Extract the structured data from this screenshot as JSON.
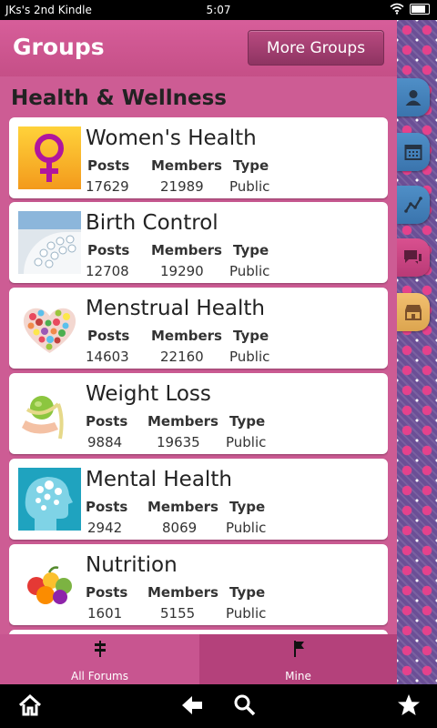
{
  "status_bar": {
    "device_name": "JKs's 2nd Kindle",
    "time": "5:07"
  },
  "header": {
    "title": "Groups",
    "more_groups_label": "More Groups"
  },
  "section_title": "Health & Wellness",
  "labels": {
    "posts": "Posts",
    "members": "Members",
    "type": "Type"
  },
  "groups": [
    {
      "name": "Women's Health",
      "posts": "17629",
      "members": "21989",
      "type": "Public",
      "thumb_icon": "female-symbol-icon"
    },
    {
      "name": "Birth Control",
      "posts": "12708",
      "members": "19290",
      "type": "Public",
      "thumb_icon": "pill-pack-icon"
    },
    {
      "name": "Menstrual Health",
      "posts": "14603",
      "members": "22160",
      "type": "Public",
      "thumb_icon": "heart-collage-icon"
    },
    {
      "name": "Weight Loss",
      "posts": "9884",
      "members": "19635",
      "type": "Public",
      "thumb_icon": "apple-measuring-tape-icon"
    },
    {
      "name": "Mental Health",
      "posts": "2942",
      "members": "8069",
      "type": "Public",
      "thumb_icon": "head-bubbles-icon"
    },
    {
      "name": "Nutrition",
      "posts": "1601",
      "members": "5155",
      "type": "Public",
      "thumb_icon": "fruit-icon"
    }
  ],
  "side_tabs": [
    "profile-icon",
    "calendar-icon",
    "chart-icon",
    "chat-icon",
    "shop-icon"
  ],
  "bottom_tabs": {
    "all_forums": "All Forums",
    "mine": "Mine"
  },
  "colors": {
    "header": "#d75e9a",
    "background": "#cd5c94",
    "tab_blue": "#4f8fc7",
    "tab_pink": "#d9508f",
    "tab_gold": "#f2c070"
  }
}
